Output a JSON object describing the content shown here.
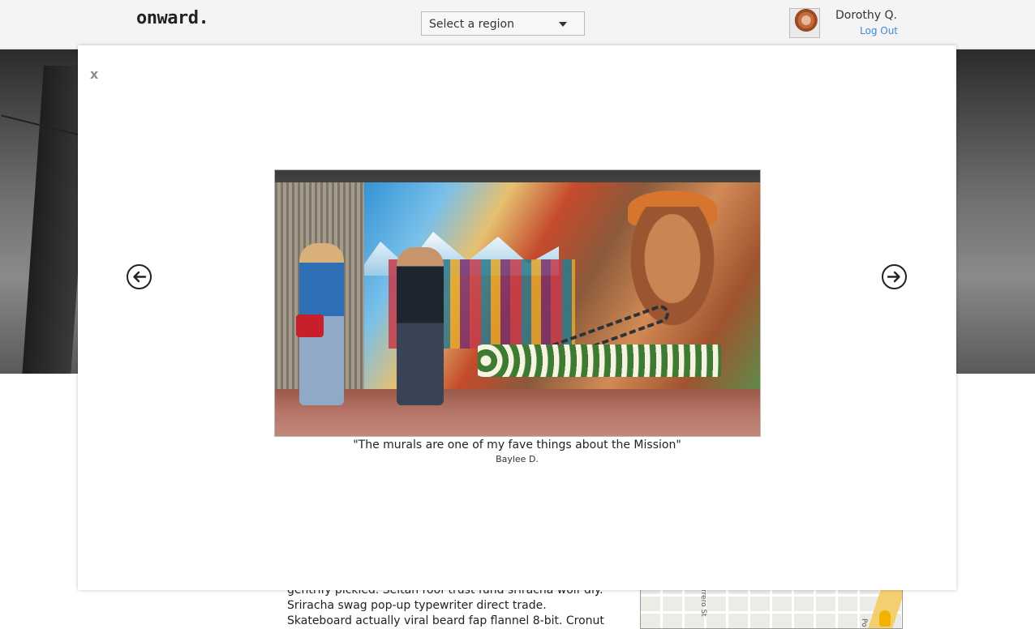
{
  "header": {
    "logo": "onward.",
    "region_select": {
      "value": "Select a region"
    },
    "user": {
      "name": "Dorothy Q.",
      "logout_label": "Log Out"
    }
  },
  "page": {
    "body_text": "gentrify pickled. Seitan roof trust fund sriracha wolf diy. Sriracha swag pop-up typewriter direct trade. Skateboard actually viral beard fap flannel 8-bit. Cronut bespoke gluten-",
    "map_labels": {
      "street_left": "rrero St",
      "street_right": "Po"
    }
  },
  "modal": {
    "close_label": "x",
    "prev_icon": "arrow-left-circle",
    "next_icon": "arrow-right-circle",
    "photo_subject": "mural",
    "quote": "\"The murals are one of my fave things about the Mission\"",
    "author": "Baylee D."
  },
  "colors": {
    "link": "#3f8bd4",
    "header_bg": "#f4f4f4"
  }
}
